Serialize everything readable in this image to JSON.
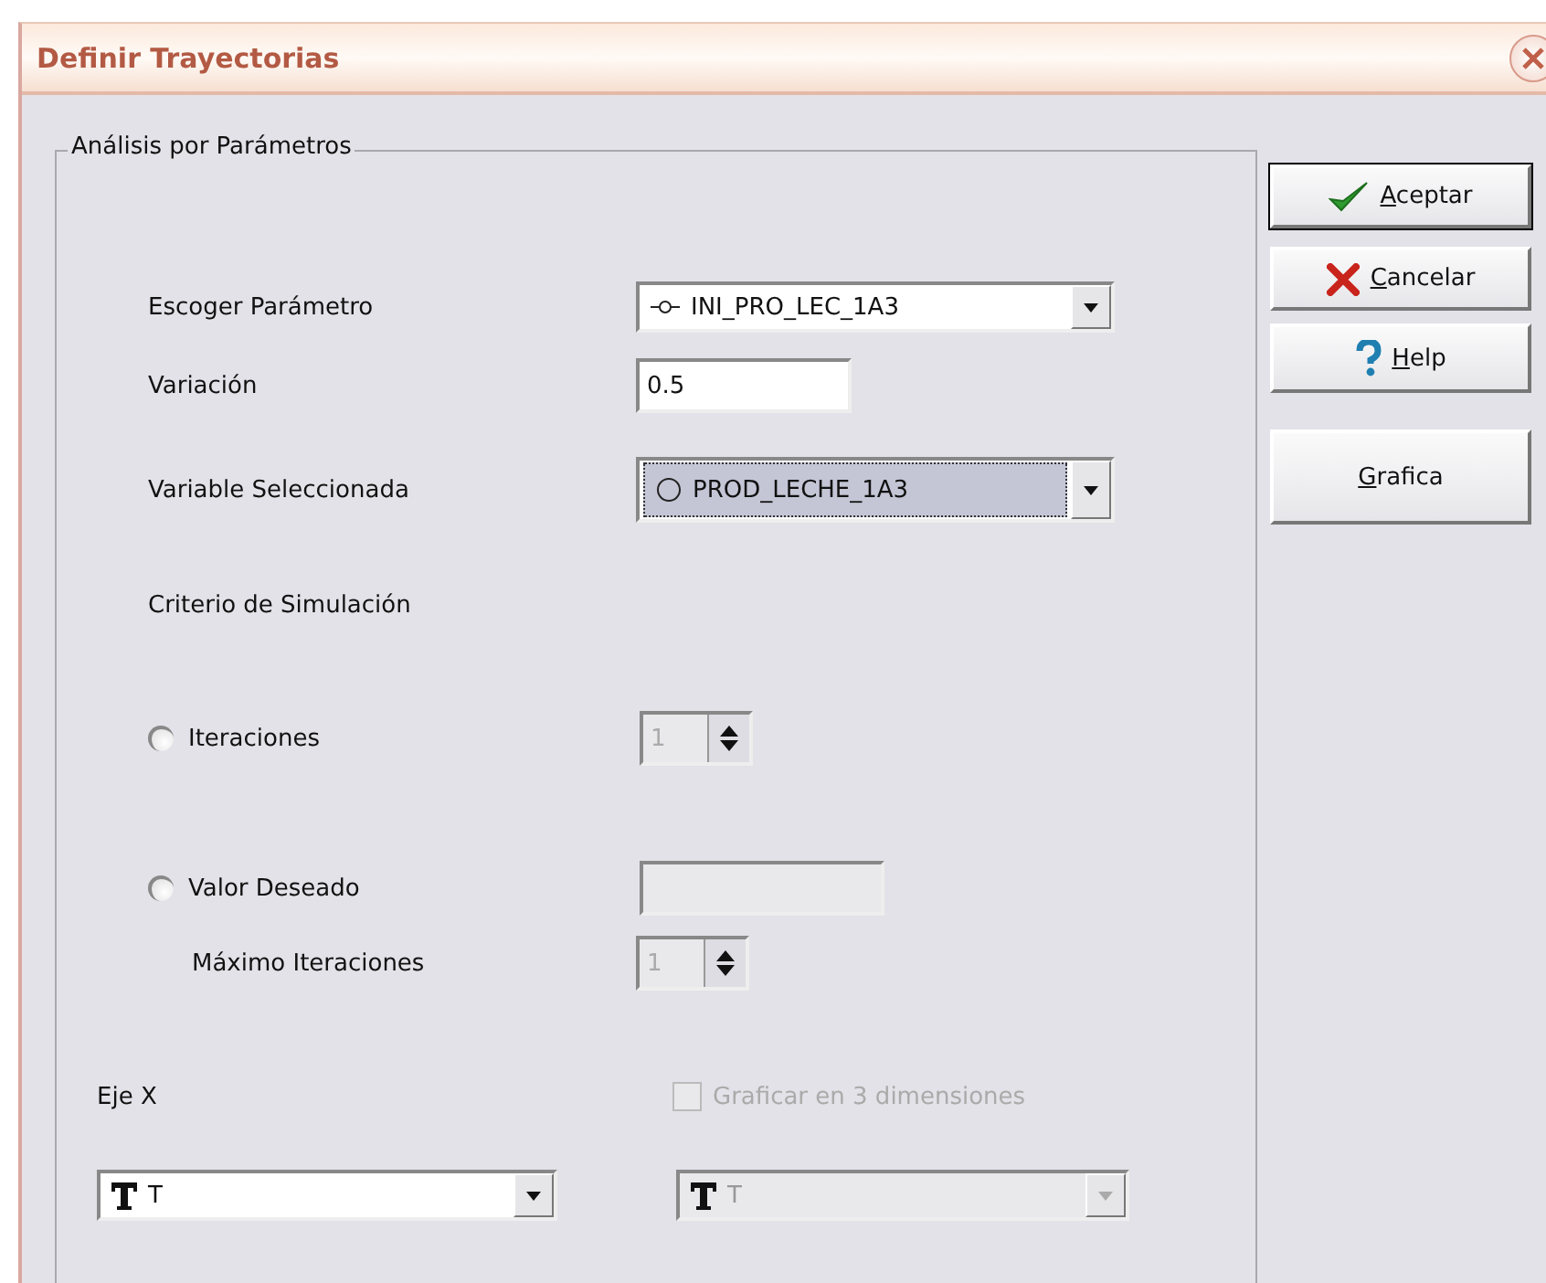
{
  "window": {
    "title": "Definir Trayectorias"
  },
  "group": {
    "title": "Análisis por Parámetros",
    "parameter": {
      "label": "Escoger Parámetro",
      "value": "INI_PRO_LEC_1A3",
      "kind": "parameter",
      "focused": false,
      "disabled": false
    },
    "variation": {
      "label": "Variación",
      "value": "0.5",
      "disabled": false
    },
    "variable": {
      "label": "Variable Seleccionada",
      "value": "PROD_LECHE_1A3",
      "kind": "variable",
      "focused": true,
      "disabled": false
    },
    "criterion": {
      "title": "Criterio de Simulación",
      "iterations": {
        "label": "Iteraciones",
        "selected": false,
        "value": "1",
        "disabled": true
      },
      "desired": {
        "label": "Valor Deseado",
        "selected": false,
        "disabled": true
      },
      "max_iterations": {
        "label": "Máximo Iteraciones",
        "value": "1",
        "disabled": true
      }
    },
    "axis_x": {
      "label": "Eje X",
      "value": "T",
      "kind": "text",
      "focused": false,
      "disabled": false
    },
    "three_d": {
      "label": "Graficar en 3 dimensiones",
      "checked": false,
      "disabled": true
    },
    "axis_y": {
      "value": "T",
      "kind": "text",
      "focused": false,
      "disabled": true
    }
  },
  "buttons": [
    {
      "label": "Aceptar",
      "kind": "check"
    },
    {
      "label": "Cancelar",
      "kind": "cross"
    },
    {
      "label": "Help",
      "kind": "question"
    },
    {
      "label": "Grafica",
      "kind": "plain"
    }
  ]
}
